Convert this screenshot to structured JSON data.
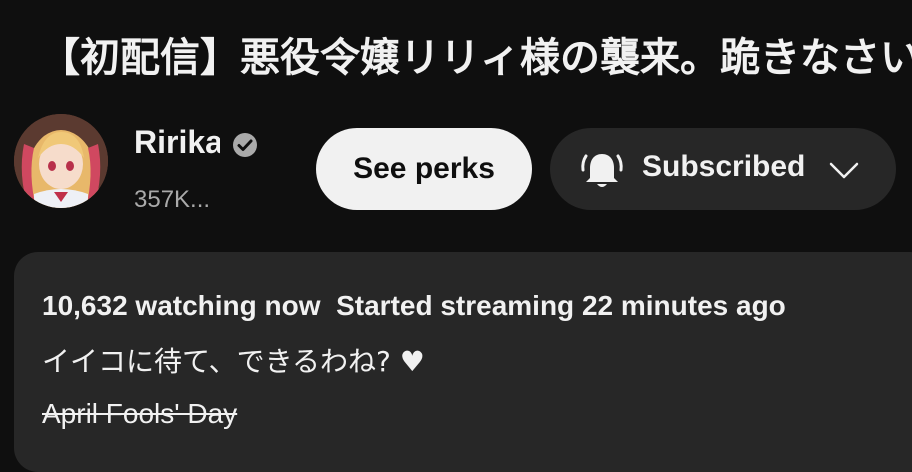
{
  "video": {
    "title": "【初配信】悪役令嬢リリィ様の襲来。跪きなさい"
  },
  "channel": {
    "name": "Ririka",
    "subscribers": "357K...",
    "verified": true
  },
  "actions": {
    "perks_label": "See perks",
    "subscribed_label": "Subscribed"
  },
  "description": {
    "watching": "10,632 watching now",
    "started": "Started streaming 22 minutes ago",
    "line1": "イイコに待て、できるわね? ♥",
    "line2": "April Fools' Day"
  },
  "colors": {
    "background": "#0f0f0f",
    "surface": "#272727",
    "text": "#f1f1f1",
    "muted": "#aaaaaa"
  }
}
